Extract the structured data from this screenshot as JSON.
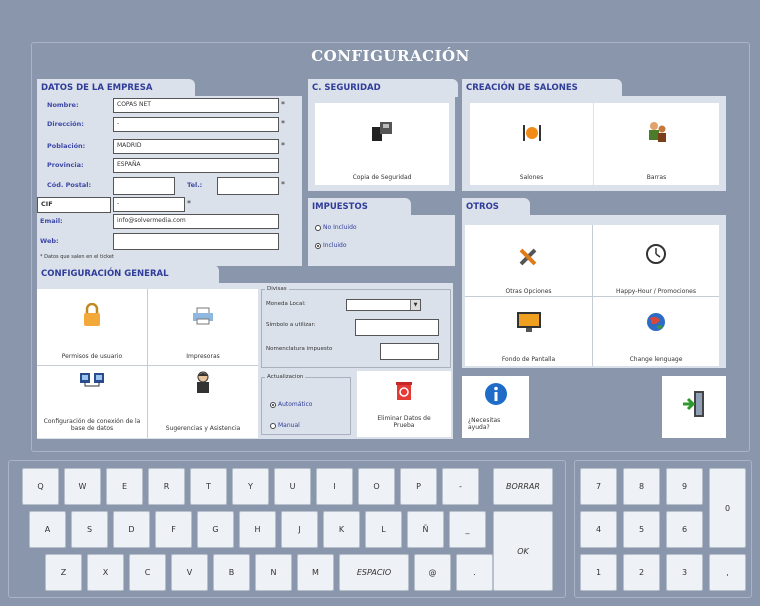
{
  "title": "CONFIGURACIÓN",
  "empresa": {
    "tab": "DATOS DE LA EMPRESA",
    "labels": {
      "nombre": "Nombre:",
      "direccion": "Dirección:",
      "poblacion": "Población:",
      "provincia": "Provincia:",
      "cp": "Cód. Postal:",
      "tel": "Tel.:",
      "cif": "CIF",
      "email": "Email:",
      "web": "Web:"
    },
    "values": {
      "nombre": "COPAS NET",
      "direccion": "-",
      "poblacion": "MADRID",
      "provincia": "ESPAÑA",
      "cp": "",
      "tel": "",
      "cif": "-",
      "email": "info@solvermedia.com",
      "web": ""
    },
    "note": "* Datos que salen en el ticket",
    "star": "*"
  },
  "seguridad": {
    "tab": "C. SEGURIDAD",
    "copia": "Copia de Seguridad"
  },
  "salones": {
    "tab": "CREACIÓN DE SALONES",
    "salones": "Salones",
    "barras": "Barras"
  },
  "impuestos": {
    "tab": "IMPUESTOS",
    "no_incluido": "No Incluido",
    "incluido": "Incluido"
  },
  "otros": {
    "tab": "OTROS",
    "otras": "Otras Opciones",
    "happy": "Happy-Hour / Promociones",
    "fondo": "Fondo de Pantalla",
    "lang": "Change lenguage",
    "ayuda": "¿Necesitas ayuda?"
  },
  "general": {
    "tab": "CONFIGURACIÓN GENERAL",
    "permisos": "Permisos de usuario",
    "impresoras": "Impresoras",
    "conexion": "Configuración de conexión de la base de datos",
    "sugerencias": "Sugerencias y Asistencia",
    "divisas": "Divisas",
    "moneda": "Moneda Local:",
    "simbolo": "Símbolo a utilizar:",
    "nomen": "Nomenclatura impuesto",
    "actualizacion": "Actualizacion",
    "automatico": "Automático",
    "manual": "Manual",
    "eliminar": "Eliminar Datos de Prueba"
  },
  "keyboard": {
    "row1": [
      "Q",
      "W",
      "E",
      "R",
      "T",
      "Y",
      "U",
      "I",
      "O",
      "P",
      "-"
    ],
    "row2": [
      "A",
      "S",
      "D",
      "F",
      "G",
      "H",
      "J",
      "K",
      "L",
      "Ñ",
      "_"
    ],
    "row3": [
      "Z",
      "X",
      "C",
      "V",
      "B",
      "N",
      "M"
    ],
    "borrar": "BORRAR",
    "ok": "OK",
    "espacio": "ESPACIO",
    "at": "@",
    "dot": "."
  },
  "numpad": {
    "r1": [
      "7",
      "8",
      "9"
    ],
    "r2": [
      "4",
      "5",
      "6"
    ],
    "r3": [
      "1",
      "2",
      "3"
    ],
    "zero": "0",
    "comma": ","
  }
}
